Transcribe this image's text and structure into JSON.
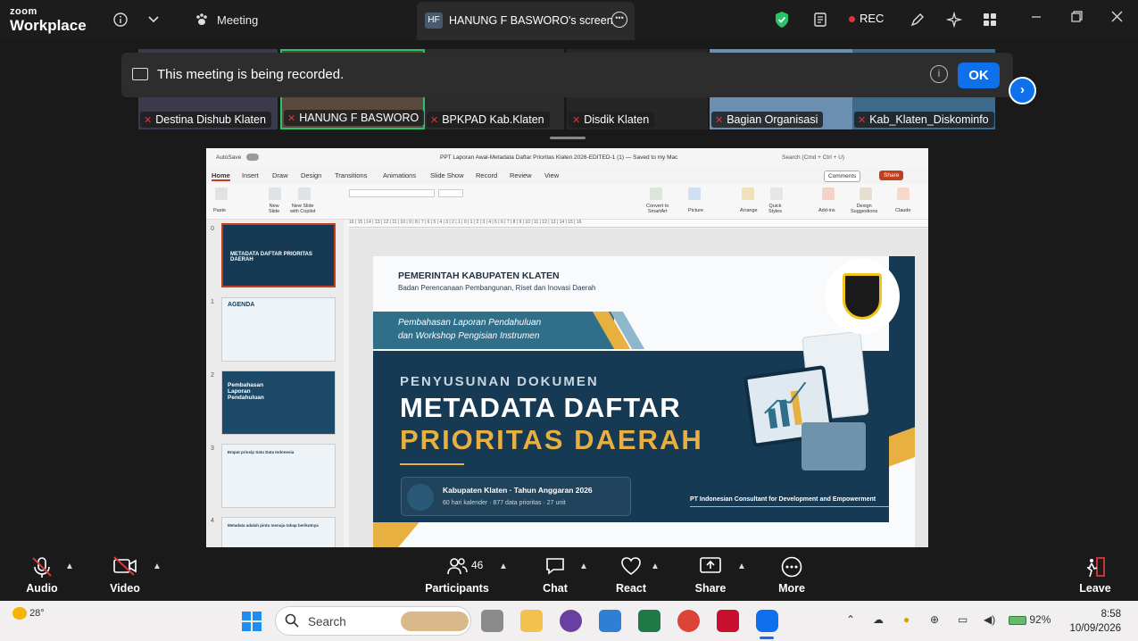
{
  "app": {
    "brand_top": "zoom",
    "brand_bottom": "Workplace",
    "meeting_label": "Meeting",
    "share_tab_initials": "HF",
    "share_tab_title": "HANUNG F BASWORO's screen",
    "rec_label": "REC"
  },
  "participants_strip": [
    {
      "name": "Destina Dishub Klaten"
    },
    {
      "name": "HANUNG F BASWORO"
    },
    {
      "name": "BPKPAD Kab.Klaten"
    },
    {
      "name": "Disdik Klaten"
    },
    {
      "name": "Bagian Organisasi"
    },
    {
      "name": "Kab_Klaten_Diskominfo"
    }
  ],
  "recording_banner": {
    "message": "This meeting is being recorded.",
    "ok_label": "OK"
  },
  "ppt": {
    "autosave": "AutoSave",
    "doc_title": "PPT Laporan Awal-Metadata Daftar Prioritas Klaten 2026-EDITED-1 (1) — Saved to my Mac",
    "search": "Search (Cmd + Ctrl + U)",
    "tabs": [
      "Home",
      "Insert",
      "Draw",
      "Design",
      "Transitions",
      "Animations",
      "Slide Show",
      "Record",
      "Review",
      "View"
    ],
    "comments_label": "Comments",
    "share_label": "Share",
    "ribbon_labels": {
      "paste": "Paste",
      "new_slide": "New\nSlide",
      "new_slide_copilot": "New Slide\nwith Copilot",
      "convert": "Convert to\nSmartArt",
      "picture": "Picture",
      "arrange": "Arrange",
      "quick_styles": "Quick\nStyles",
      "addins": "Add-ins",
      "design_suggestions": "Design\nSuggestions",
      "claude": "Claude"
    },
    "ruler": "16 | 15 | 14 | 13 | 12 | 11 | 10 | 9 | 8 | 7 | 6 | 5 | 4 | 3 | 2 | 1 | 0 | 1 | 2 | 3 | 4 | 5 | 6 | 7 | 8 | 9 | 10 | 11 | 12 | 13 | 14 | 15 | 16",
    "thumb_numbers": [
      "0",
      "1",
      "2",
      "3",
      "4"
    ],
    "thumbs": [
      {
        "title": "METADATA DAFTAR PRIORITAS DAERAH"
      },
      {
        "title": "AGENDA"
      },
      {
        "title": "Pembahasan Laporan Pendahuluan"
      },
      {
        "title": "Empat prinsip Satu Data Indonesia"
      },
      {
        "title": "Metadata adalah pintu menuju tahap berikutnya"
      }
    ]
  },
  "slide": {
    "org_line1": "PEMERINTAH KABUPATEN KLATEN",
    "org_line2": "Badan Perencanaan Pembangunan, Riset dan Inovasi Daerah",
    "band_line1": "Pembahasan Laporan Pendahuluan",
    "band_line2": "dan Workshop Pengisian Instrumen",
    "subtitle": "PENYUSUNAN DOKUMEN",
    "title_line1": "METADATA DAFTAR",
    "title_line2": "PRIORITAS DAERAH",
    "info_line1": "Kabupaten Klaten  ·  Tahun Anggaran 2026",
    "info_line2": "60 hari kalender  ·  877 data prioritas  ·  27 unit",
    "consultant": "PT Indonesian Consultant for Development and Empowerment"
  },
  "controls": {
    "audio": "Audio",
    "video": "Video",
    "participants": "Participants",
    "participants_count": "46",
    "chat": "Chat",
    "react": "React",
    "share": "Share",
    "more": "More",
    "leave": "Leave"
  },
  "taskbar": {
    "weather_temp": "28°",
    "search_placeholder": "Search",
    "battery": "92%",
    "time": "8:58",
    "date": "10/09/2026"
  },
  "colors": {
    "zoom_blue": "#0e71eb",
    "rec_red": "#e0323c",
    "active_green": "#28c468",
    "slide_navy": "#163a54",
    "slide_gold": "#e8b040",
    "ppt_accent": "#c43e1c"
  }
}
